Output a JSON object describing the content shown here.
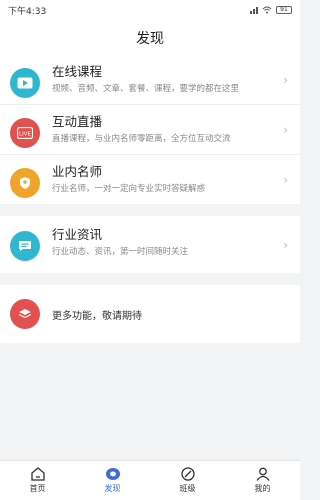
{
  "status_bar": {
    "time": "下午4:33",
    "battery": "91"
  },
  "header": {
    "title": "发现"
  },
  "items": [
    {
      "title": "在线课程",
      "desc": "视频、音频、文章、套餐、课程，要学的都在这里",
      "color": "#2fb7d0",
      "icon": "play-icon"
    },
    {
      "title": "互动直播",
      "desc": "直播课程，与业内名师零距离，全方位互动交流",
      "color": "#e35050",
      "icon": "live-icon"
    },
    {
      "title": "业内名师",
      "desc": "行业名师，一对一定向专业实时答疑解惑",
      "color": "#f0a42a",
      "icon": "teacher-icon"
    }
  ],
  "news": {
    "title": "行业资讯",
    "desc": "行业动态、资讯，第一时间随时关注",
    "color": "#2fb7d0",
    "icon": "news-icon"
  },
  "more": {
    "label": "更多功能，敬请期待",
    "color": "#e35050",
    "icon": "layers-icon"
  },
  "tabs": [
    {
      "label": "首页",
      "icon": "home-icon"
    },
    {
      "label": "发现",
      "icon": "discover-icon",
      "active": true
    },
    {
      "label": "班级",
      "icon": "class-icon"
    },
    {
      "label": "我的",
      "icon": "profile-icon"
    }
  ],
  "colors": {
    "accent": "#3d6bd8"
  }
}
